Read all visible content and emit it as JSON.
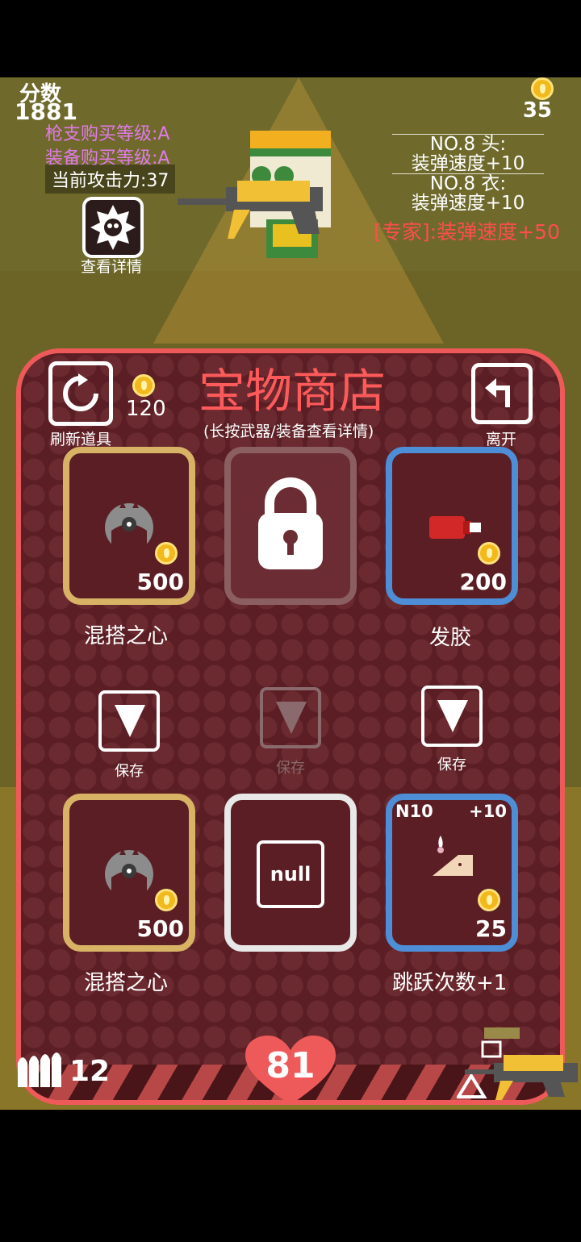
{
  "hud": {
    "score_label": "分数",
    "score_value": "1881",
    "gun_level": "枪支购买等级:A",
    "equip_level": "装备购买等级:A",
    "attack": "当前攻击力:37",
    "coins": "35",
    "detail_label": "查看详情",
    "equipment": {
      "head_title": "NO.8 头:",
      "head_effect": "装弹速度+10",
      "body_title": "NO.8 衣:",
      "body_effect": "装弹速度+10",
      "expert": "[专家]:装弹速度+50"
    },
    "ammo": "12",
    "health": "81"
  },
  "shop": {
    "title": "宝物商店",
    "subtitle": "(长按武器/装备查看详情)",
    "refresh_label": "刷新道具",
    "refresh_cost": "120",
    "exit_label": "离开",
    "save_label": "保存",
    "items": [
      {
        "name": "混搭之心",
        "price": "500",
        "state": "gold"
      },
      {
        "name": "",
        "price": "",
        "state": "locked"
      },
      {
        "name": "发胶",
        "price": "200",
        "state": "blue"
      },
      {
        "name": "混搭之心",
        "price": "500",
        "state": "gold"
      },
      {
        "name": "",
        "price": "",
        "state": "null",
        "null_text": "null"
      },
      {
        "name": "跳跃次数+1",
        "price": "25",
        "state": "blue",
        "tag_left": "N10",
        "tag_right": "+10"
      }
    ]
  },
  "colors": {
    "panel_border": "#ee5a5a",
    "panel_bg": "#5a1e24",
    "gold_frame": "#d8b366",
    "blue_frame": "#4e8ed6",
    "level_text": "#e07be6",
    "expert_text": "#ff4d4d"
  }
}
